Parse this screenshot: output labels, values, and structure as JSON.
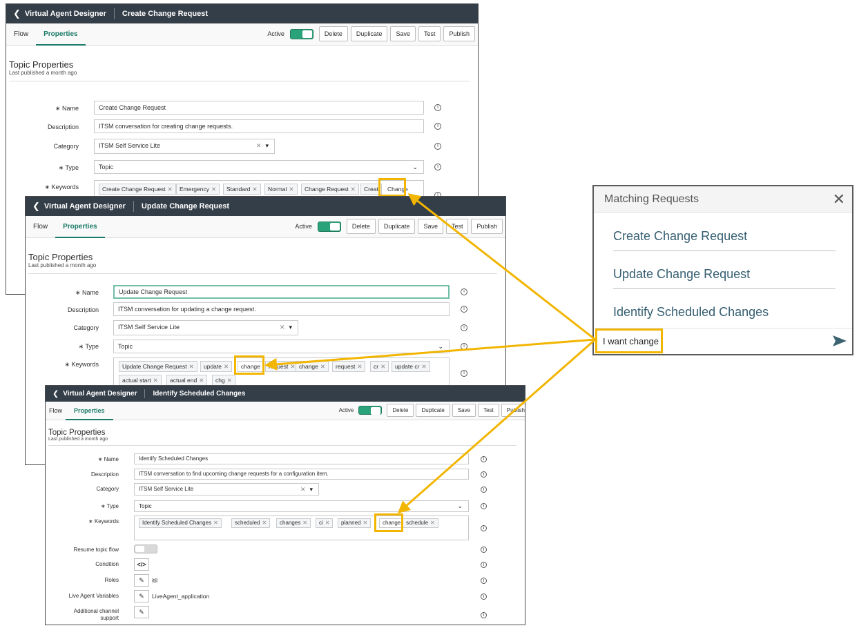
{
  "windows": [
    {
      "app_title": "Virtual Agent Designer",
      "topic_title": "Create Change Request",
      "tabs": [
        "Flow",
        "Properties"
      ],
      "active_label": "Active",
      "buttons": [
        "Delete",
        "Duplicate",
        "Save",
        "Test",
        "Publish"
      ],
      "section_title": "Topic Properties",
      "section_sub": "Last published a month ago",
      "labels": {
        "name": "∗ Name",
        "description": "Description",
        "category": "Category",
        "type": "∗ Type",
        "keywords": "∗ Keywords"
      },
      "name": "Create Change Request",
      "description": "ITSM conversation for creating change requests.",
      "category": "ITSM Self Service Lite",
      "type": "Topic",
      "keywords": [
        "Create Change Request",
        "Emergency",
        "Standard",
        "Normal",
        "Change Request",
        "Creat",
        "Change"
      ]
    },
    {
      "app_title": "Virtual Agent Designer",
      "topic_title": "Update Change Request",
      "tabs": [
        "Flow",
        "Properties"
      ],
      "active_label": "Active",
      "buttons": [
        "Delete",
        "Duplicate",
        "Save",
        "Test",
        "Publish"
      ],
      "section_title": "Topic Properties",
      "section_sub": "Last published a month ago",
      "labels": {
        "name": "∗ Name",
        "description": "Description",
        "category": "Category",
        "type": "∗ Type",
        "keywords": "∗ Keywords"
      },
      "name": "Update Change Request",
      "description": "ITSM conversation for updating a change request.",
      "category": "ITSM Self Service Lite",
      "type": "Topic",
      "keywords": [
        "Update Change Request",
        "update",
        "change",
        "request",
        "change",
        "request",
        "cr",
        "update cr",
        "actual start",
        "actual end",
        "chg"
      ]
    },
    {
      "app_title": "Virtual Agent Designer",
      "topic_title": "Identify Scheduled Changes",
      "tabs": [
        "Flow",
        "Properties"
      ],
      "active_label": "Active",
      "buttons": [
        "Delete",
        "Duplicate",
        "Save",
        "Test",
        "Publish"
      ],
      "section_title": "Topic Properties",
      "section_sub": "Last published a month ago",
      "labels": {
        "name": "∗ Name",
        "description": "Description",
        "category": "Category",
        "type": "∗ Type",
        "keywords": "∗ Keywords",
        "resume": "Resume topic flow",
        "condition": "Condition",
        "roles": "Roles",
        "live_agent": "Live Agent Variables",
        "channel": "Additional channel support"
      },
      "name": "Identify Scheduled Changes",
      "description": "ITSM conversation to find upcoming change requests for a configuration item.",
      "category": "ITSM Self Service Lite",
      "type": "Topic",
      "keywords": [
        "Identify Scheduled Changes",
        "scheduled",
        "changes",
        "ci",
        "planned",
        "change",
        "schedule"
      ],
      "roles_value": "itil",
      "live_agent_value": "LiveAgent_application",
      "condition_symbol": "</>"
    }
  ],
  "matching": {
    "title": "Matching Requests",
    "items": [
      "Create Change Request",
      "Update Change Request",
      "Identify Scheduled Changes"
    ],
    "input_text": "I want change"
  },
  "icons": {
    "back": "chevron-left-icon",
    "info": "info-circle-icon",
    "close": "close-icon",
    "send": "send-icon",
    "edit": "pencil-icon"
  },
  "colors": {
    "titlebar": "#343e48",
    "accent": "#1a7a67",
    "highlight": "#f2b500",
    "toggle_on": "#2aa37a",
    "match_link": "#365f72"
  }
}
